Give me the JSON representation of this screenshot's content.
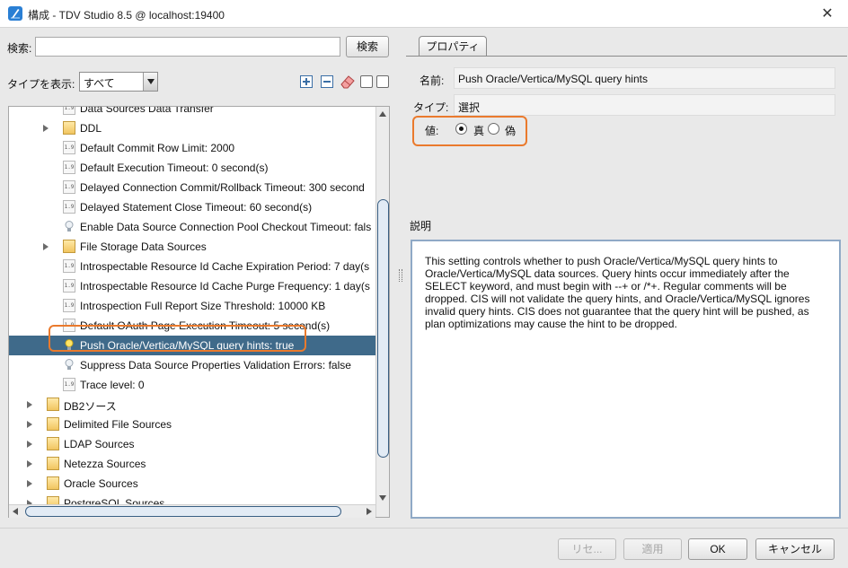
{
  "window": {
    "title": "構成 - TDV Studio 8.5 @ localhost:19400",
    "close": "✕"
  },
  "left": {
    "search_label": "検索:",
    "search_value": "",
    "search_button": "検索",
    "type_label": "タイプを表示:",
    "type_selected": "すべて"
  },
  "tree": {
    "rows": [
      {
        "text": "Data Sources Data Transfer",
        "icon": "number-icon",
        "indent": 1
      },
      {
        "text": "DDL",
        "icon": "folder-icon",
        "indent": 1,
        "expander": true
      },
      {
        "text": "Default Commit Row Limit: 2000",
        "icon": "number-icon",
        "indent": 1
      },
      {
        "text": "Default Execution Timeout: 0 second(s)",
        "icon": "number-icon",
        "indent": 1
      },
      {
        "text": "Delayed Connection Commit/Rollback Timeout: 300 second",
        "icon": "number-icon",
        "indent": 1
      },
      {
        "text": "Delayed Statement Close Timeout: 60 second(s)",
        "icon": "number-icon",
        "indent": 1
      },
      {
        "text": "Enable Data Source Connection Pool Checkout Timeout: fals",
        "icon": "bulb-icon",
        "indent": 1
      },
      {
        "text": "File Storage Data Sources",
        "icon": "folder-icon",
        "indent": 1,
        "expander": true
      },
      {
        "text": "Introspectable Resource Id Cache Expiration Period: 7 day(s",
        "icon": "number-icon",
        "indent": 1
      },
      {
        "text": "Introspectable Resource Id Cache Purge Frequency: 1 day(s",
        "icon": "number-icon",
        "indent": 1
      },
      {
        "text": "Introspection Full Report Size Threshold: 10000 KB",
        "icon": "number-icon",
        "indent": 1
      },
      {
        "text": "Default OAuth Page Execution Timeout: 5 second(s)",
        "icon": "number-icon",
        "indent": 1
      },
      {
        "text": "Push Oracle/Vertica/MySQL query hints: true",
        "icon": "bulb-lit-icon",
        "indent": 1,
        "selected": true
      },
      {
        "text": "Suppress Data Source Properties Validation Errors: false",
        "icon": "bulb-icon",
        "indent": 1
      },
      {
        "text": "Trace level: 0",
        "icon": "number-icon",
        "indent": 1
      },
      {
        "text": "DB2ソース",
        "icon": "folder-icon",
        "indent": 0,
        "expander": true
      },
      {
        "text": "Delimited File Sources",
        "icon": "folder-icon",
        "indent": 0,
        "expander": true
      },
      {
        "text": "LDAP Sources",
        "icon": "folder-icon",
        "indent": 0,
        "expander": true
      },
      {
        "text": "Netezza Sources",
        "icon": "folder-icon",
        "indent": 0,
        "expander": true
      },
      {
        "text": "Oracle Sources",
        "icon": "folder-icon",
        "indent": 0,
        "expander": true
      },
      {
        "text": "PostgreSQL Sources",
        "icon": "folder-icon",
        "indent": 0,
        "expander": true
      }
    ]
  },
  "properties": {
    "tab_label": "プロパティ",
    "name_label": "名前:",
    "name_value": "Push Oracle/Vertica/MySQL query hints",
    "type_label": "タイプ:",
    "type_value": "選択",
    "value_label": "値:",
    "radio_true": "真",
    "radio_false": "偽",
    "radio_selected": "true",
    "description_label": "説明",
    "description": "This setting controls whether to push Oracle/Vertica/MySQL query hints to Oracle/Vertica/MySQL data sources. Query hints occur immediately after the SELECT keyword, and must begin with --+ or /*+. Regular comments will be dropped. CIS will not validate the query hints, and Oracle/Vertica/MySQL ignores invalid query hints. CIS does not guarantee that the query hint will be pushed, as plan optimizations may cause the hint to be dropped."
  },
  "footer": {
    "reset": "リセ...",
    "apply": "適用",
    "ok": "OK",
    "cancel": "キャンセル"
  },
  "colors": {
    "selection": "#3f6a8a",
    "highlight": "#ea7a2d"
  }
}
